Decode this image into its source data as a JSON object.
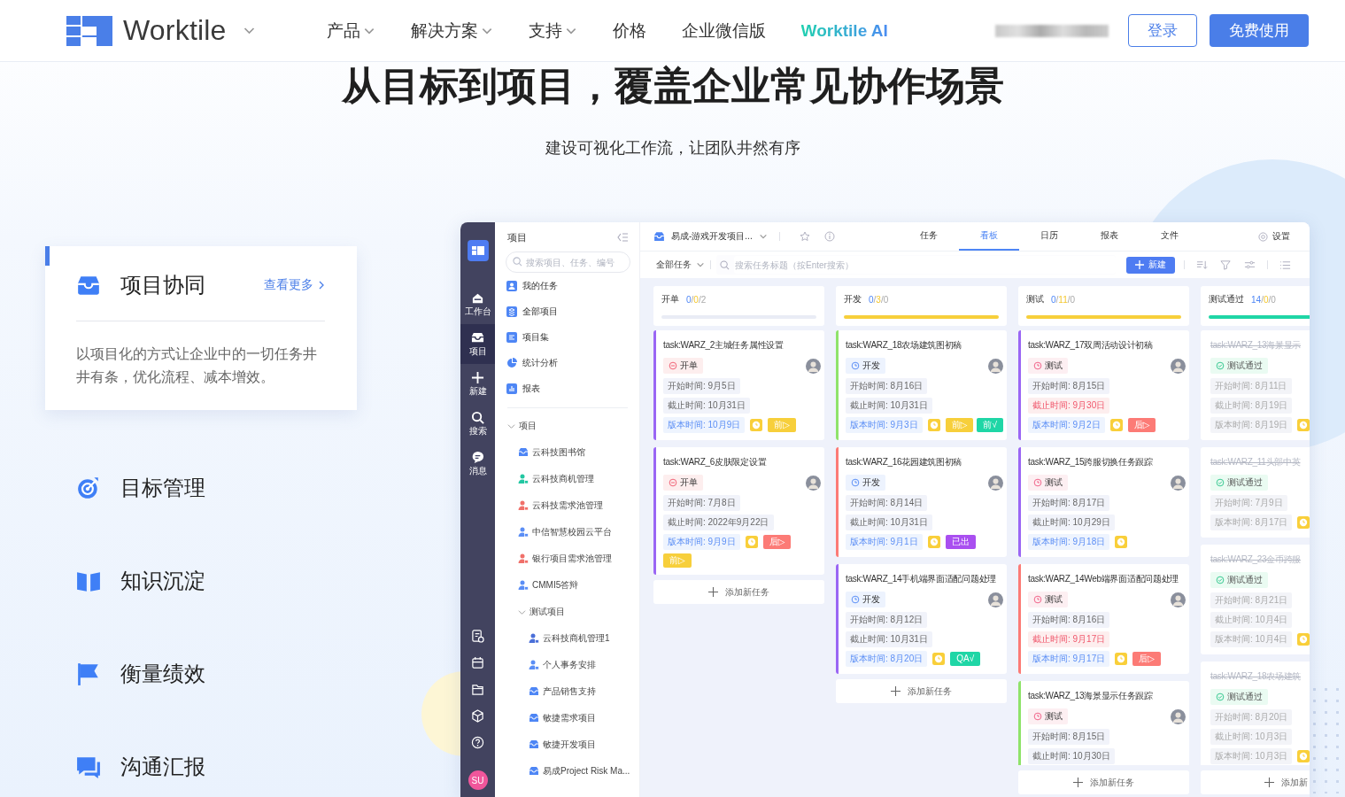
{
  "header": {
    "brand": "Worktile",
    "nav": [
      {
        "label": "产品",
        "dropdown": true,
        "kind": "plain"
      },
      {
        "label": "解决方案",
        "dropdown": true,
        "kind": "plain"
      },
      {
        "label": "支持",
        "dropdown": true,
        "kind": "plain"
      },
      {
        "label": "价格",
        "dropdown": false,
        "kind": "plain"
      },
      {
        "label": "企业微信版",
        "dropdown": false,
        "kind": "plain"
      },
      {
        "label": "Worktile AI",
        "dropdown": false,
        "kind": "highlight"
      }
    ],
    "login": "登录",
    "signup": "免费使用"
  },
  "hero": {
    "title": "从目标到项目，覆盖企业常见协作场景",
    "subtitle": "建设可视化工作流，让团队井然有序"
  },
  "features": [
    {
      "title": "项目协同",
      "selected": true,
      "link": "查看更多",
      "description": "以项目化的方式让企业中的一切任务井井有条，优化流程、减本增效。"
    },
    {
      "title": "目标管理",
      "selected": false
    },
    {
      "title": "知识沉淀",
      "selected": false
    },
    {
      "title": "衡量绩效",
      "selected": false
    },
    {
      "title": "沟通汇报",
      "selected": false
    }
  ],
  "app": {
    "rail": {
      "items": [
        {
          "label": "工作台",
          "selected": false
        },
        {
          "label": "项目",
          "selected": true
        },
        {
          "label": "新建",
          "selected": false
        },
        {
          "label": "搜索",
          "selected": false
        },
        {
          "label": "消息",
          "selected": false
        }
      ],
      "avatar": "SU"
    },
    "panel": {
      "title": "项目",
      "search_placeholder": "搜索项目、任务、编号",
      "nav": [
        "我的任务",
        "全部项目",
        "项目集",
        "统计分析",
        "报表"
      ],
      "tree": [
        {
          "label": "项目",
          "kind": "group",
          "expanded": true,
          "children": [
            {
              "label": "云科技图书馆",
              "kind": "inbox",
              "color": "#4e86f5"
            },
            {
              "label": "云科技商机管理",
              "kind": "person",
              "color": "#22c7a2"
            },
            {
              "label": "云科技需求池管理",
              "kind": "person",
              "color": "#f0706a"
            },
            {
              "label": "中信智慧校园云平台",
              "kind": "person",
              "color": "#5b8ef5"
            },
            {
              "label": "银行项目需求池管理",
              "kind": "person",
              "color": "#f0706a"
            },
            {
              "label": "CMMI5答辩",
              "kind": "person",
              "color": "#5b8ef5"
            },
            {
              "label": "测试项目",
              "kind": "group",
              "expanded": true,
              "children": [
                {
                  "label": "云科技商机管理1",
                  "kind": "person",
                  "color": "#4a6fd8"
                },
                {
                  "label": "个人事务安排",
                  "kind": "person",
                  "color": "#5b8ef5"
                },
                {
                  "label": "产品销售支持",
                  "kind": "inbox",
                  "color": "#4e86f5"
                },
                {
                  "label": "敏捷需求项目",
                  "kind": "inbox",
                  "color": "#4e86f5"
                },
                {
                  "label": "敏捷开发项目",
                  "kind": "inbox",
                  "color": "#4e86f5"
                },
                {
                  "label": "易成Project Risk Ma...",
                  "kind": "inbox",
                  "color": "#4e86f5"
                }
              ]
            }
          ]
        }
      ]
    },
    "project": "易成-游戏开发项目...",
    "tabs": [
      {
        "label": "任务",
        "selected": false
      },
      {
        "label": "看板",
        "selected": true
      },
      {
        "label": "日历",
        "selected": false
      },
      {
        "label": "报表",
        "selected": false
      },
      {
        "label": "文件",
        "selected": false
      }
    ],
    "settings": "设置",
    "filter": "全部任务",
    "search_placeholder": "搜索任务标题（按Enter搜索）",
    "new_button": "新建",
    "board": {
      "columns": [
        {
          "name": "开单",
          "counts": "0/0/2",
          "color": "#e9ecf5",
          "add": "添加新任务",
          "cards": [
            {
              "title": "task:WARZ_2主城任务属性设置",
              "color": "#9a66f4",
              "done": false,
              "avatar": true,
              "status": {
                "label": "开单",
                "kind": "open"
              },
              "start": "开始时间: 9月5日",
              "due": "截止时间: 10月31日",
              "overdue": false,
              "version": "版本时间: 10月9日",
              "clock": true,
              "tags": [
                {
                  "label": "前▷",
                  "color": "#f7cf3b"
                }
              ]
            },
            {
              "title": "task:WARZ_6皮肤限定设置",
              "color": "#9a66f4",
              "done": false,
              "avatar": true,
              "status": {
                "label": "开单",
                "kind": "open"
              },
              "start": "开始时间: 7月8日",
              "due": "截止时间: 2022年9月22日",
              "overdue": false,
              "version": "版本时间: 9月9日",
              "clock": true,
              "tags": [
                {
                  "label": "后▷",
                  "color": "#fc7b76"
                },
                {
                  "label": "前▷",
                  "color": "#f7cf3b"
                }
              ]
            }
          ]
        },
        {
          "name": "开发",
          "counts": "0/3/0",
          "color": "#f7cf3b",
          "add": "添加新任务",
          "cards": [
            {
              "title": "task:WARZ_18农场建筑图初稿",
              "color": "#8fe36a",
              "done": false,
              "avatar": true,
              "status": {
                "label": "开发",
                "kind": "dev"
              },
              "start": "开始时间: 8月16日",
              "due": "截止时间: 10月31日",
              "overdue": false,
              "version": "版本时间: 9月3日",
              "clock": true,
              "tags": [
                {
                  "label": "前▷",
                  "color": "#f7cf3b"
                },
                {
                  "label": "前√",
                  "color": "#1fd6a6"
                }
              ]
            },
            {
              "title": "task:WARZ_16花园建筑图初稿",
              "color": "#fc7b76",
              "done": false,
              "avatar": true,
              "status": {
                "label": "开发",
                "kind": "dev"
              },
              "start": "开始时间: 8月14日",
              "due": "截止时间: 10月31日",
              "overdue": false,
              "version": "版本时间: 9月1日",
              "clock": true,
              "tags": [
                {
                  "label": "已出",
                  "color": "#a94ff0"
                }
              ]
            },
            {
              "title": "task:WARZ_14手机端界面适配问题处理",
              "color": "#9a66f4",
              "done": false,
              "avatar": true,
              "status": {
                "label": "开发",
                "kind": "dev"
              },
              "start": "开始时间: 8月12日",
              "due": "截止时间: 10月31日",
              "overdue": false,
              "version": "版本时间: 8月20日",
              "clock": true,
              "tags": [
                {
                  "label": "QA√",
                  "color": "#1fd6a6"
                }
              ]
            }
          ]
        },
        {
          "name": "测试",
          "counts": "0/11/0",
          "color": "#f7cf3b",
          "add": "添加新任务",
          "cards": [
            {
              "title": "task:WARZ_17双周活动设计初稿",
              "color": "#9a66f4",
              "done": false,
              "avatar": true,
              "status": {
                "label": "测试",
                "kind": "test"
              },
              "start": "开始时间: 8月15日",
              "due": "截止时间: 9月30日",
              "overdue": true,
              "version": "版本时间: 9月2日",
              "clock": true,
              "tags": [
                {
                  "label": "后▷",
                  "color": "#fc7b76"
                }
              ]
            },
            {
              "title": "task:WARZ_15跨服切换任务跟踪",
              "color": "#9a66f4",
              "done": false,
              "avatar": true,
              "status": {
                "label": "测试",
                "kind": "test"
              },
              "start": "开始时间: 8月17日",
              "due": "截止时间: 10月29日",
              "overdue": false,
              "version": "版本时间: 9月18日",
              "clock": true
            },
            {
              "title": "task:WARZ_14Web端界面适配问题处理",
              "color": "#fc7b76",
              "done": false,
              "avatar": true,
              "status": {
                "label": "测试",
                "kind": "test"
              },
              "start": "开始时间: 8月16日",
              "due": "截止时间: 9月17日",
              "overdue": true,
              "version": "版本时间: 9月17日",
              "clock": true,
              "tags": [
                {
                  "label": "后▷",
                  "color": "#fc7b76"
                }
              ]
            },
            {
              "title": "task:WARZ_13海景显示任务跟踪",
              "color": "#8fe36a",
              "done": false,
              "avatar": true,
              "status": {
                "label": "测试",
                "kind": "test"
              },
              "start": "开始时间: 8月15日",
              "due": "截止时间: 10月30日",
              "overdue": false,
              "clock": false
            }
          ]
        },
        {
          "name": "测试通过",
          "counts": "14/0/0",
          "color": "#1fd6a6",
          "add": "添加新",
          "cards": [
            {
              "title": "task:WARZ_13海景显示",
              "color": "#ffffff",
              "done": true,
              "avatar": false,
              "status": {
                "label": "测试通过",
                "kind": "passed"
              },
              "start": "开始时间: 8月11日",
              "due": "截止时间: 8月19日",
              "overdue": false,
              "version": "版本时间: 8月19日",
              "clock": true
            },
            {
              "title": "task:WARZ_11头部中英",
              "color": "#ffffff",
              "done": true,
              "avatar": false,
              "status": {
                "label": "测试通过",
                "kind": "passed"
              },
              "start": "开始时间: 7月9日",
              "version": "版本时间: 8月17日",
              "clock": true
            },
            {
              "title": "task:WARZ_23金币跨服",
              "color": "#ffffff",
              "done": true,
              "avatar": false,
              "status": {
                "label": "测试通过",
                "kind": "passed"
              },
              "start": "开始时间: 8月21日",
              "due": "截止时间: 10月4日",
              "overdue": false,
              "version": "版本时间: 10月4日",
              "clock": true
            },
            {
              "title": "task:WARZ_18农场建筑",
              "color": "#ffffff",
              "done": true,
              "avatar": false,
              "status": {
                "label": "测试通过",
                "kind": "passed"
              },
              "start": "开始时间: 8月20日",
              "due": "截止时间: 10月3日",
              "overdue": false,
              "version": "版本时间: 10月3日",
              "clock": true
            }
          ]
        }
      ]
    }
  }
}
